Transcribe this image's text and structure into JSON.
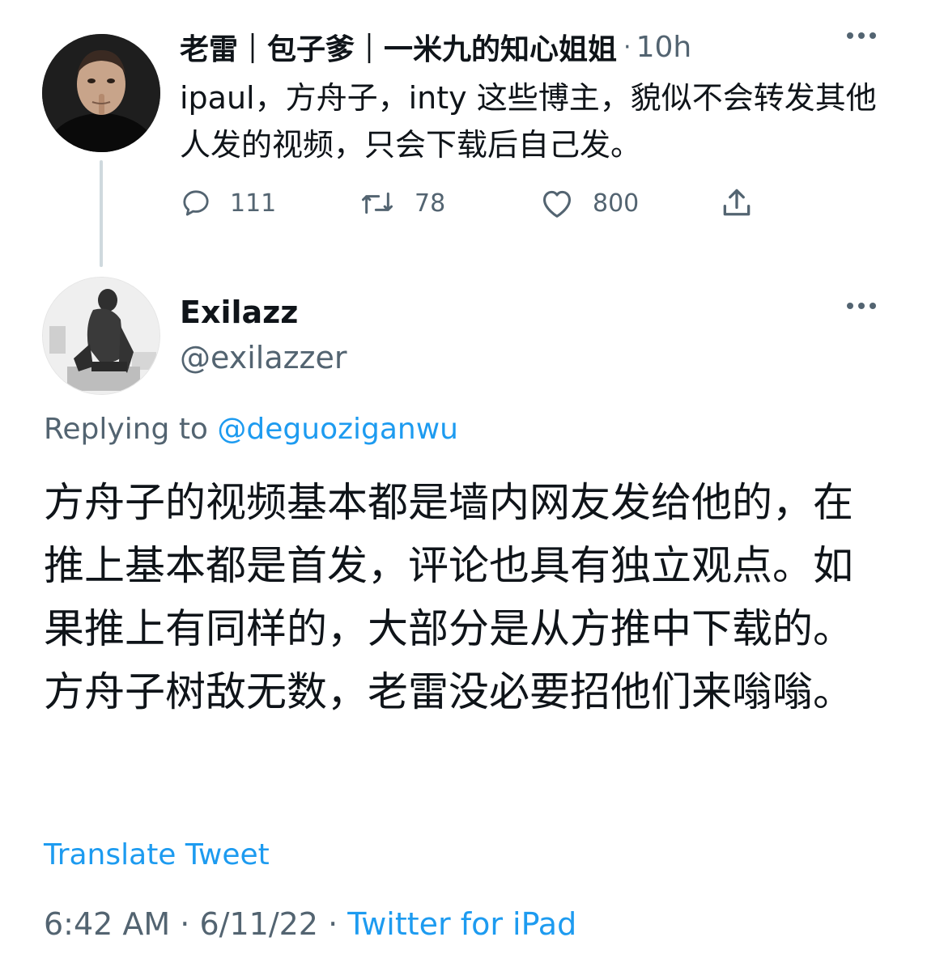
{
  "parent_tweet": {
    "author_name": "老雷｜包子爹｜一米九的知心姐姐",
    "separator": "·",
    "time_ago": "10h",
    "text": "ipaul，方舟子，inty 这些博主，貌似不会转发其他人发的视频，只会下载后自己发。",
    "actions": {
      "reply_count": "111",
      "retweet_count": "78",
      "like_count": "800"
    }
  },
  "reply_tweet": {
    "author_name": "Exilazz",
    "handle": "@exilazzer",
    "replying_prefix": "Replying to",
    "replying_to": "@deguoziganwu",
    "text": "方舟子的视频基本都是墙内网友发给他的，在推上基本都是首发，评论也具有独立观点。如果推上有同样的，大部分是从方推中下载的。方舟子树敌无数，老雷没必要招他们来嗡嗡。",
    "translate_label": "Translate Tweet",
    "time": "6:42 AM",
    "date": "6/11/22",
    "dot": "·",
    "source": "Twitter for iPad"
  },
  "colors": {
    "text_primary": "#0f1419",
    "text_secondary": "#536471",
    "link": "#1d9bf0",
    "thread_line": "#cfd9de"
  },
  "icons": [
    "reply-icon",
    "retweet-icon",
    "like-icon",
    "share-icon",
    "more-icon"
  ]
}
